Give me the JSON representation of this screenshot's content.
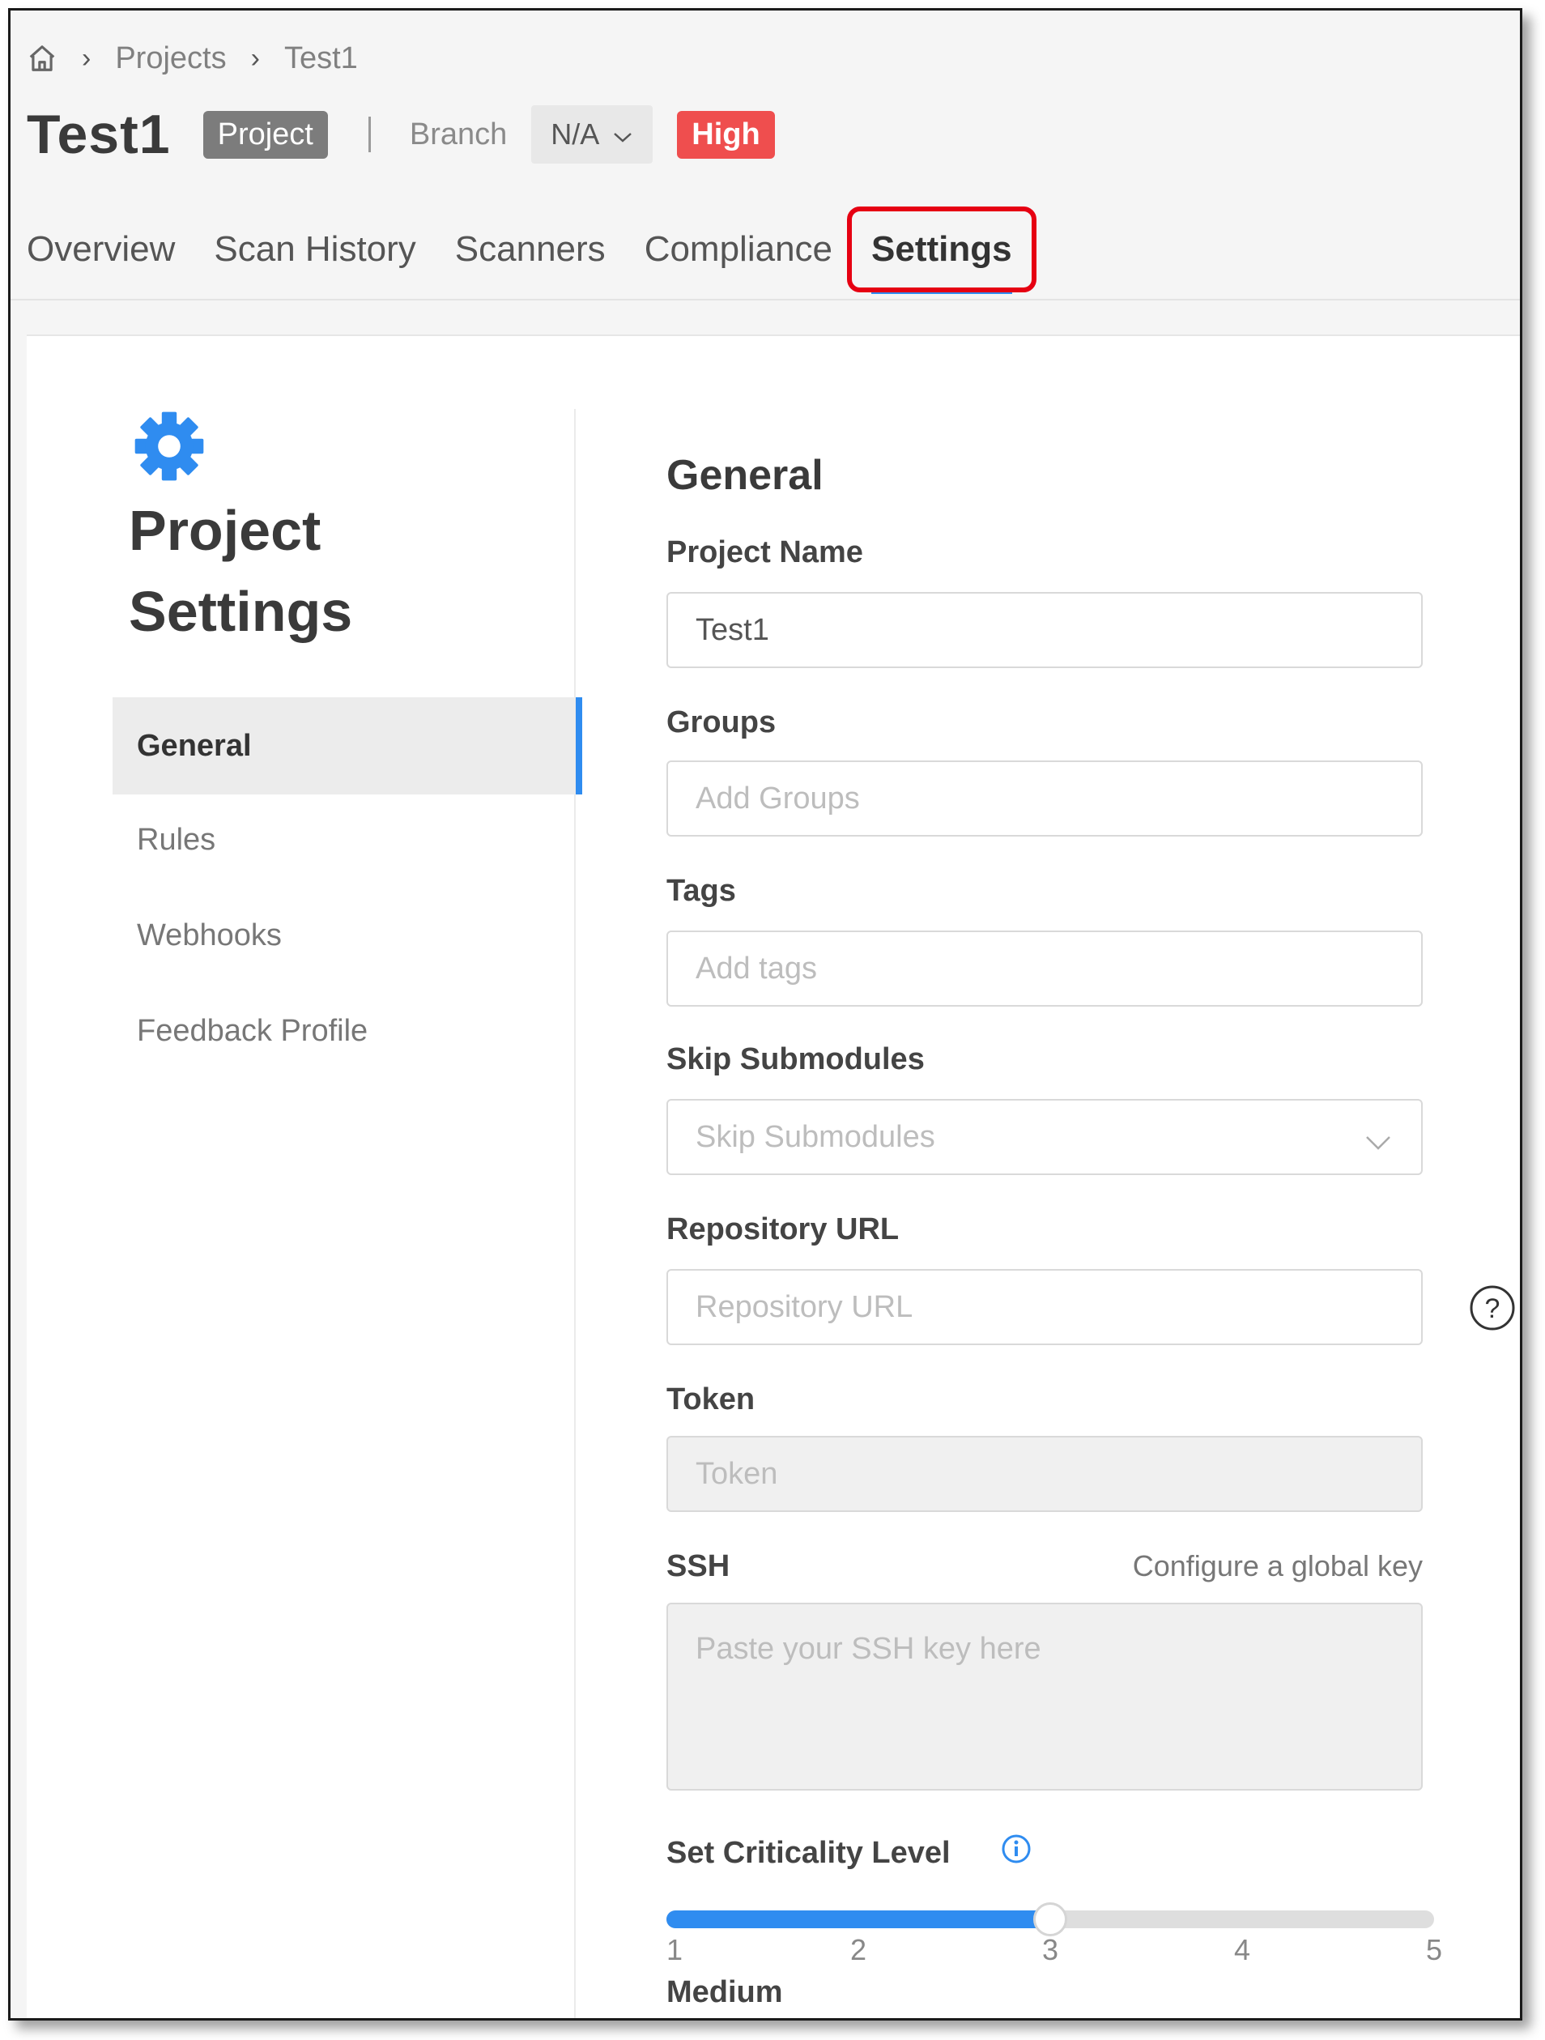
{
  "breadcrumb": {
    "items": [
      "Projects",
      "Test1"
    ]
  },
  "header": {
    "title": "Test1",
    "type_badge": "Project",
    "branch_label": "Branch",
    "branch_value": "N/A",
    "severity_badge": "High",
    "severity_color": "#ef4e4e"
  },
  "tabs": [
    {
      "label": "Overview"
    },
    {
      "label": "Scan History"
    },
    {
      "label": "Scanners"
    },
    {
      "label": "Compliance"
    },
    {
      "label": "Settings",
      "active": true
    }
  ],
  "sidebar": {
    "title_line1": "Project",
    "title_line2": "Settings",
    "items": [
      {
        "label": "General",
        "active": true
      },
      {
        "label": "Rules"
      },
      {
        "label": "Webhooks"
      },
      {
        "label": "Feedback Profile"
      }
    ]
  },
  "form": {
    "section_title": "General",
    "project_name": {
      "label": "Project Name",
      "value": "Test1"
    },
    "groups": {
      "label": "Groups",
      "placeholder": "Add Groups"
    },
    "tags": {
      "label": "Tags",
      "placeholder": "Add tags"
    },
    "skip_submodules": {
      "label": "Skip Submodules",
      "placeholder": "Skip Submodules"
    },
    "repository_url": {
      "label": "Repository URL",
      "placeholder": "Repository URL"
    },
    "token": {
      "label": "Token",
      "placeholder": "Token"
    },
    "ssh": {
      "label": "SSH",
      "link": "Configure a global key",
      "placeholder": "Paste your SSH key here"
    },
    "criticality": {
      "label": "Set Criticality Level",
      "ticks": [
        "1",
        "2",
        "3",
        "4",
        "5"
      ],
      "value": 3,
      "min": 1,
      "max": 5,
      "level_label": "Medium"
    }
  },
  "colors": {
    "accent": "#2f8cf0",
    "highlight": "#e60012"
  }
}
